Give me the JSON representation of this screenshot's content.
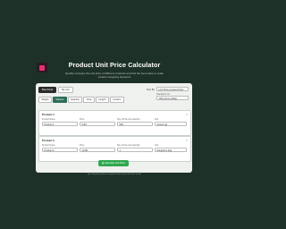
{
  "header": {
    "title": "Product Unit Price Calculator",
    "subtitle": "Quickly compare the unit price of different products and find the best value to make smarter shopping decisions"
  },
  "mode": {
    "options": [
      "Best Deal",
      "By List"
    ]
  },
  "sort": {
    "label": "Sort By",
    "value": "Unit Price (Lowest First)"
  },
  "standard_unit": {
    "label": "Standard Unit",
    "value": "100 grams (100g)"
  },
  "unit_tabs": [
    "Weight",
    "Volume",
    "Quantity",
    "Area",
    "Length",
    "Custom"
  ],
  "products": [
    {
      "title": "Product 1",
      "name_label": "Product Name",
      "name_value": "Product 1",
      "price_label": "Price",
      "price_value": "5.99",
      "size_label": "Size (of the unit quantity)",
      "size_value": "500",
      "unit_label": "Unit",
      "unit_value": "Grams (g)"
    },
    {
      "title": "Product 2",
      "name_label": "Product Name",
      "name_value": "Product 2",
      "price_label": "Price",
      "price_value": "10.99",
      "size_label": "Size (of the unit quantity)",
      "size_value": "1",
      "unit_label": "Unit",
      "unit_value": "Kilograms (kg)"
    }
  ],
  "actions": {
    "calculate": "Calculate Unit Price"
  },
  "footer": {
    "text": "Tip: Compare products using the same unit for the best results"
  },
  "colors": {
    "background": "#1e3129",
    "accent_tab": "#2f6f5a",
    "calculate_button": "#2fa84f",
    "logo": "#e3306c"
  }
}
